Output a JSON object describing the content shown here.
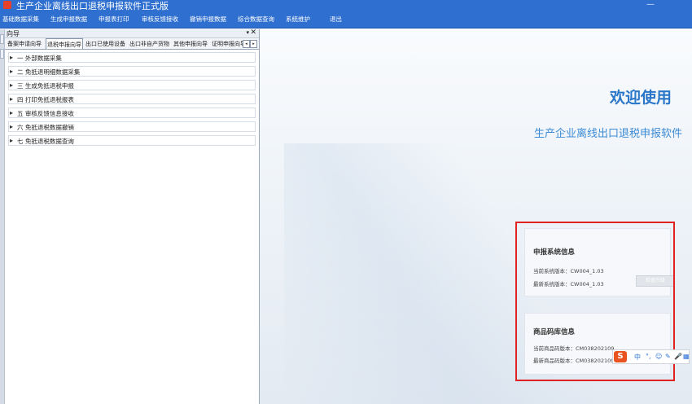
{
  "window": {
    "title": "生产企业离线出口退税申报软件正式版",
    "controls_hint": "—"
  },
  "menu": [
    "基础数据采集",
    "生成申报数据",
    "申报表打印",
    "审核反馈接收",
    "撤销申报数据",
    "综合数据查询",
    "系统维护",
    "退出"
  ],
  "nav": {
    "title": "向导",
    "pin": "▾",
    "close": "✕",
    "tabs": [
      "备案申请向导",
      "退税申报向导",
      "出口已使用设备",
      "出口非自产货物",
      "其他申报向导",
      "证明申报向导"
    ],
    "active_tab": 1,
    "tree": [
      "一  外部数据采集",
      "二  免抵退明细数据采集",
      "三  生成免抵退税申报",
      "四  打印免抵退税报表",
      "五  审核反馈信息接收",
      "六  免抵退税数据撤销",
      "七  免抵退税数据查询"
    ]
  },
  "content": {
    "welcome": "欢迎使用",
    "subtitle": "生产企业离线出口退税申报软件",
    "system_info": {
      "title": "申报系统信息",
      "current_label": "当前系统版本：",
      "current_value": "CW004_1.03",
      "latest_label": "最新系统版本：",
      "latest_value": "CW004_1.03",
      "check_button": "检查升级"
    },
    "code_info": {
      "title": "商品码库信息",
      "current_label": "当前商品码版本：",
      "current_value": "CM038202109",
      "latest_label": "最新商品码版本：",
      "latest_value": "CM038202109"
    }
  },
  "ime": {
    "logo": "S",
    "icons": [
      "中",
      "°,",
      "☺",
      "✎",
      "🎤",
      "▦"
    ]
  },
  "colors": {
    "titlebar": "#2f6fd0",
    "accent_text": "#2a76c9",
    "highlight_box": "#e02222"
  }
}
